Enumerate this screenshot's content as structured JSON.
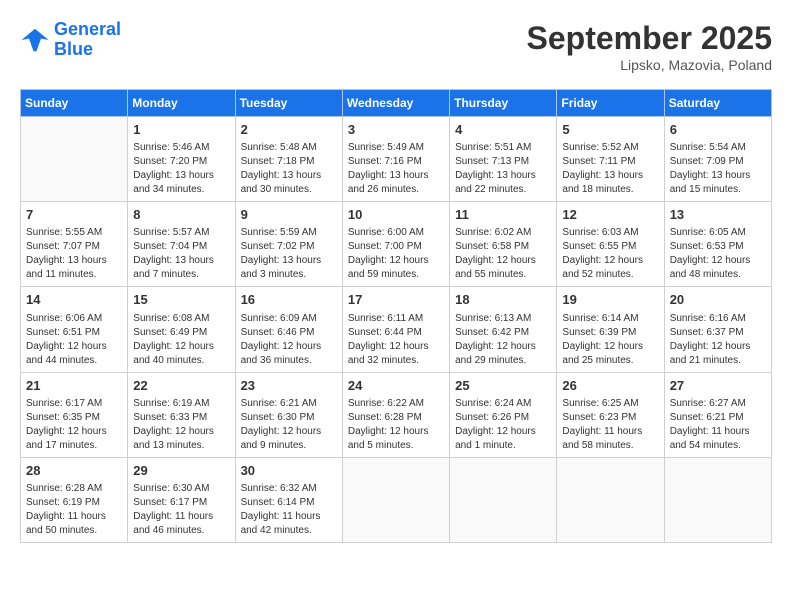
{
  "header": {
    "logo_line1": "General",
    "logo_line2": "Blue",
    "month": "September 2025",
    "location": "Lipsko, Mazovia, Poland"
  },
  "days_of_week": [
    "Sunday",
    "Monday",
    "Tuesday",
    "Wednesday",
    "Thursday",
    "Friday",
    "Saturday"
  ],
  "weeks": [
    [
      {
        "day": "",
        "empty": true
      },
      {
        "day": "1",
        "sunrise": "5:46 AM",
        "sunset": "7:20 PM",
        "daylight": "13 hours and 34 minutes."
      },
      {
        "day": "2",
        "sunrise": "5:48 AM",
        "sunset": "7:18 PM",
        "daylight": "13 hours and 30 minutes."
      },
      {
        "day": "3",
        "sunrise": "5:49 AM",
        "sunset": "7:16 PM",
        "daylight": "13 hours and 26 minutes."
      },
      {
        "day": "4",
        "sunrise": "5:51 AM",
        "sunset": "7:13 PM",
        "daylight": "13 hours and 22 minutes."
      },
      {
        "day": "5",
        "sunrise": "5:52 AM",
        "sunset": "7:11 PM",
        "daylight": "13 hours and 18 minutes."
      },
      {
        "day": "6",
        "sunrise": "5:54 AM",
        "sunset": "7:09 PM",
        "daylight": "13 hours and 15 minutes."
      }
    ],
    [
      {
        "day": "7",
        "sunrise": "5:55 AM",
        "sunset": "7:07 PM",
        "daylight": "13 hours and 11 minutes."
      },
      {
        "day": "8",
        "sunrise": "5:57 AM",
        "sunset": "7:04 PM",
        "daylight": "13 hours and 7 minutes."
      },
      {
        "day": "9",
        "sunrise": "5:59 AM",
        "sunset": "7:02 PM",
        "daylight": "13 hours and 3 minutes."
      },
      {
        "day": "10",
        "sunrise": "6:00 AM",
        "sunset": "7:00 PM",
        "daylight": "12 hours and 59 minutes."
      },
      {
        "day": "11",
        "sunrise": "6:02 AM",
        "sunset": "6:58 PM",
        "daylight": "12 hours and 55 minutes."
      },
      {
        "day": "12",
        "sunrise": "6:03 AM",
        "sunset": "6:55 PM",
        "daylight": "12 hours and 52 minutes."
      },
      {
        "day": "13",
        "sunrise": "6:05 AM",
        "sunset": "6:53 PM",
        "daylight": "12 hours and 48 minutes."
      }
    ],
    [
      {
        "day": "14",
        "sunrise": "6:06 AM",
        "sunset": "6:51 PM",
        "daylight": "12 hours and 44 minutes."
      },
      {
        "day": "15",
        "sunrise": "6:08 AM",
        "sunset": "6:49 PM",
        "daylight": "12 hours and 40 minutes."
      },
      {
        "day": "16",
        "sunrise": "6:09 AM",
        "sunset": "6:46 PM",
        "daylight": "12 hours and 36 minutes."
      },
      {
        "day": "17",
        "sunrise": "6:11 AM",
        "sunset": "6:44 PM",
        "daylight": "12 hours and 32 minutes."
      },
      {
        "day": "18",
        "sunrise": "6:13 AM",
        "sunset": "6:42 PM",
        "daylight": "12 hours and 29 minutes."
      },
      {
        "day": "19",
        "sunrise": "6:14 AM",
        "sunset": "6:39 PM",
        "daylight": "12 hours and 25 minutes."
      },
      {
        "day": "20",
        "sunrise": "6:16 AM",
        "sunset": "6:37 PM",
        "daylight": "12 hours and 21 minutes."
      }
    ],
    [
      {
        "day": "21",
        "sunrise": "6:17 AM",
        "sunset": "6:35 PM",
        "daylight": "12 hours and 17 minutes."
      },
      {
        "day": "22",
        "sunrise": "6:19 AM",
        "sunset": "6:33 PM",
        "daylight": "12 hours and 13 minutes."
      },
      {
        "day": "23",
        "sunrise": "6:21 AM",
        "sunset": "6:30 PM",
        "daylight": "12 hours and 9 minutes."
      },
      {
        "day": "24",
        "sunrise": "6:22 AM",
        "sunset": "6:28 PM",
        "daylight": "12 hours and 5 minutes."
      },
      {
        "day": "25",
        "sunrise": "6:24 AM",
        "sunset": "6:26 PM",
        "daylight": "12 hours and 1 minute."
      },
      {
        "day": "26",
        "sunrise": "6:25 AM",
        "sunset": "6:23 PM",
        "daylight": "11 hours and 58 minutes."
      },
      {
        "day": "27",
        "sunrise": "6:27 AM",
        "sunset": "6:21 PM",
        "daylight": "11 hours and 54 minutes."
      }
    ],
    [
      {
        "day": "28",
        "sunrise": "6:28 AM",
        "sunset": "6:19 PM",
        "daylight": "11 hours and 50 minutes."
      },
      {
        "day": "29",
        "sunrise": "6:30 AM",
        "sunset": "6:17 PM",
        "daylight": "11 hours and 46 minutes."
      },
      {
        "day": "30",
        "sunrise": "6:32 AM",
        "sunset": "6:14 PM",
        "daylight": "11 hours and 42 minutes."
      },
      {
        "day": "",
        "empty": true
      },
      {
        "day": "",
        "empty": true
      },
      {
        "day": "",
        "empty": true
      },
      {
        "day": "",
        "empty": true
      }
    ]
  ]
}
